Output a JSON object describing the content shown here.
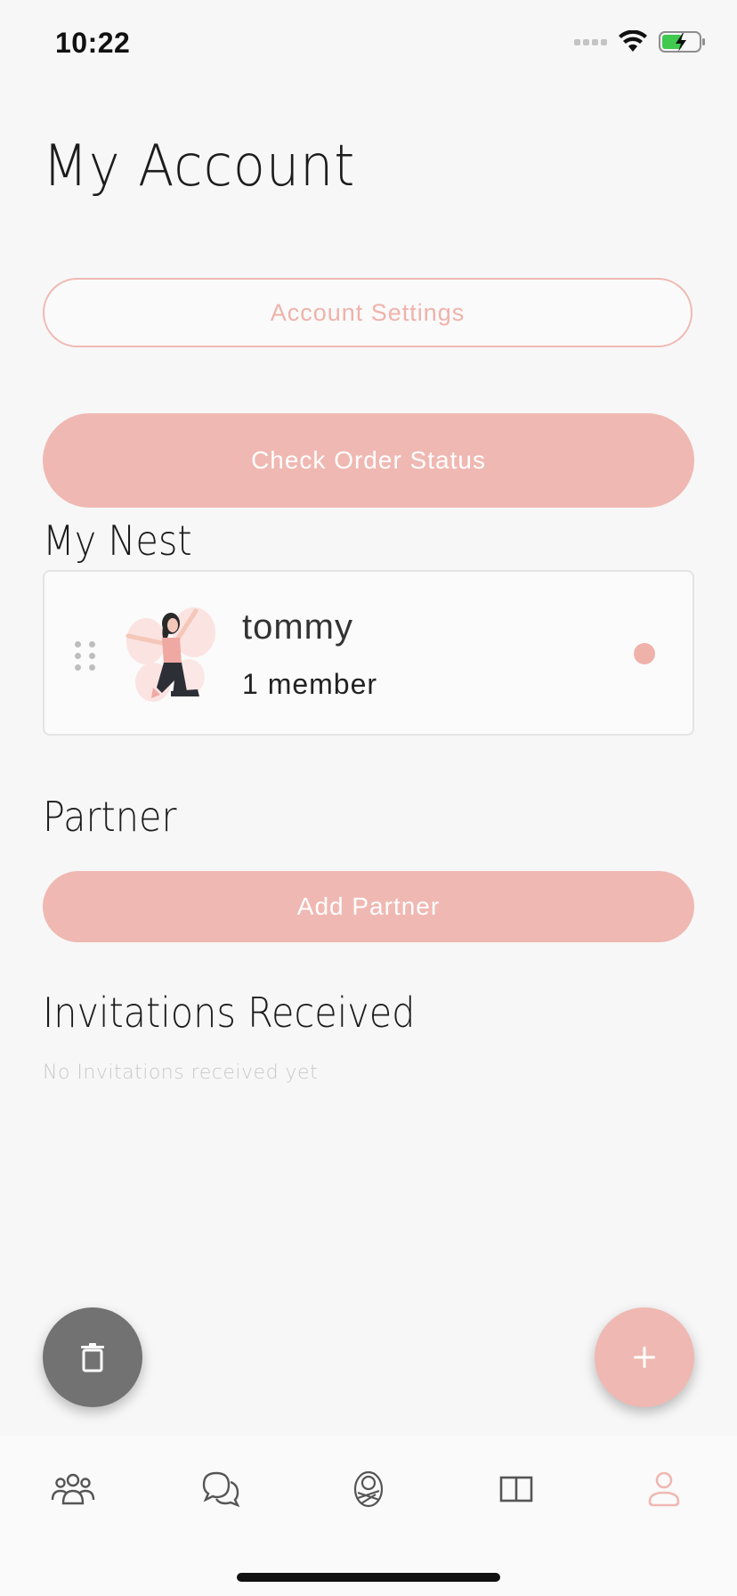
{
  "status_bar": {
    "time": "10:22",
    "icons": [
      "signal-icon",
      "wifi-icon",
      "battery-charging-icon"
    ]
  },
  "page": {
    "title": "My Account"
  },
  "buttons": {
    "account_settings": "Account Settings",
    "check_order_status": "Check Order Status",
    "add_partner": "Add Partner"
  },
  "sections": {
    "my_nest": "My Nest",
    "partner": "Partner",
    "invitations": "Invitations Received"
  },
  "nest": {
    "name": "tommy",
    "members": "1 member"
  },
  "invitations": {
    "empty_text": "No Invitations received yet"
  },
  "fabs": {
    "delete_icon": "trash-icon",
    "add_icon": "plus-icon"
  },
  "tab_bar": {
    "items": [
      {
        "icon": "community-icon"
      },
      {
        "icon": "chat-icon"
      },
      {
        "icon": "baby-icon"
      },
      {
        "icon": "book-icon"
      },
      {
        "icon": "profile-icon",
        "active": true
      }
    ]
  },
  "colors": {
    "accent": "#f0b8b2",
    "accent_text": "#efb2ab",
    "background": "#f7f7f7",
    "fab_delete": "#727272",
    "icon_inactive": "#555555"
  }
}
